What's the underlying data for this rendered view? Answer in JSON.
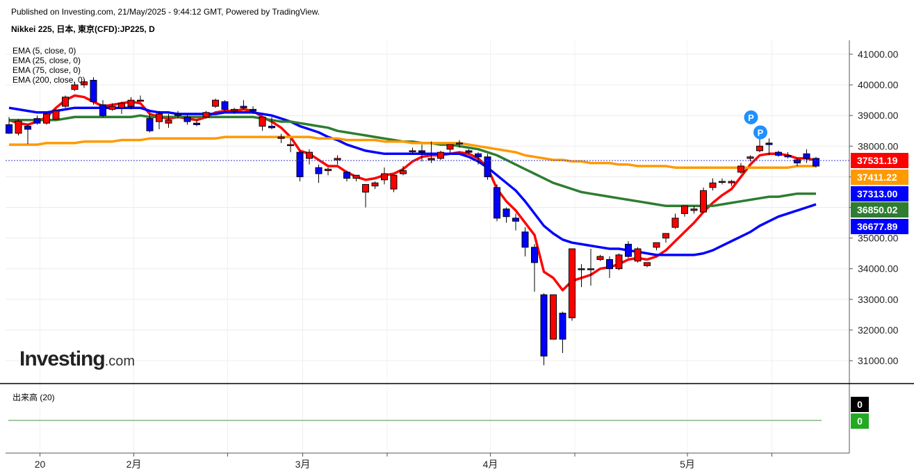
{
  "header": {
    "published": "Published on Investing.com, 21/May/2025 - 9:44:12 GMT, Powered by TradingView.",
    "symbol": "Nikkei 225, 日本, 東京(CFD):JP225, D"
  },
  "logo": {
    "main": "Investing",
    "suffix": ".com"
  },
  "volume": {
    "label": "出来高 (20)",
    "values": [
      "0",
      "0"
    ],
    "colors": [
      "#000000",
      "#22aa22"
    ]
  },
  "chart_data": {
    "type": "candlestick",
    "x_tick_labels": [
      "20",
      "2月",
      "3月",
      "4月",
      "5月"
    ],
    "y_tick_labels": [
      "31000.00",
      "32000.00",
      "33000.00",
      "34000.00",
      "35000.00",
      "36000.00",
      "37000.00",
      "38000.00",
      "39000.00",
      "40000.00",
      "41000.00"
    ],
    "ylim": [
      30000,
      41500
    ],
    "candles": [
      [
        38700,
        38950,
        38400,
        38420
      ],
      [
        38420,
        38880,
        38350,
        38820
      ],
      [
        38650,
        38700,
        38070,
        38550
      ],
      [
        38900,
        39000,
        38700,
        38750
      ],
      [
        38750,
        39100,
        38700,
        39050
      ],
      [
        38880,
        39200,
        38850,
        39150
      ],
      [
        39300,
        39650,
        39250,
        39600
      ],
      [
        39850,
        40100,
        39800,
        40000
      ],
      [
        40000,
        40200,
        39900,
        40100
      ],
      [
        40150,
        40250,
        39350,
        39450
      ],
      [
        39350,
        39500,
        38950,
        39000
      ],
      [
        39200,
        39400,
        39150,
        39300
      ],
      [
        39250,
        39450,
        39050,
        39400
      ],
      [
        39300,
        39600,
        39200,
        39500
      ],
      [
        39500,
        39650,
        39450,
        39500
      ],
      [
        38900,
        39050,
        38450,
        38500
      ],
      [
        38800,
        39150,
        38550,
        39050
      ],
      [
        38750,
        39050,
        38600,
        38850
      ],
      [
        39050,
        39150,
        38900,
        39000
      ],
      [
        38950,
        39050,
        38700,
        38800
      ],
      [
        38750,
        38850,
        38650,
        38700
      ],
      [
        38950,
        39150,
        38900,
        39100
      ],
      [
        39300,
        39550,
        39250,
        39500
      ],
      [
        39450,
        39500,
        39150,
        39200
      ],
      [
        39150,
        39250,
        39050,
        39200
      ],
      [
        39300,
        39500,
        39200,
        39250
      ],
      [
        39200,
        39300,
        39050,
        39150
      ],
      [
        38650,
        38950,
        38500,
        38950
      ],
      [
        38650,
        38950,
        38550,
        38600
      ],
      [
        38250,
        38400,
        38100,
        38300
      ],
      [
        38050,
        38250,
        37800,
        38050
      ],
      [
        37800,
        37850,
        36850,
        37000
      ],
      [
        37600,
        37900,
        37400,
        37800
      ],
      [
        37300,
        37400,
        36800,
        37100
      ],
      [
        37200,
        37300,
        37050,
        37250
      ],
      [
        37550,
        37700,
        37400,
        37600
      ],
      [
        37150,
        37200,
        36850,
        36950
      ],
      [
        36950,
        37050,
        36850,
        37050
      ],
      [
        36500,
        36750,
        36000,
        36750
      ],
      [
        36700,
        36850,
        36600,
        36800
      ],
      [
        36900,
        37300,
        36750,
        37100
      ],
      [
        36600,
        37050,
        36500,
        37050
      ],
      [
        37100,
        37350,
        37050,
        37200
      ],
      [
        37850,
        37950,
        37750,
        37850
      ],
      [
        37850,
        38050,
        37500,
        37800
      ],
      [
        37550,
        38150,
        37450,
        37600
      ],
      [
        37600,
        37850,
        37550,
        37800
      ],
      [
        37900,
        38050,
        37750,
        38050
      ],
      [
        38100,
        38200,
        37950,
        38100
      ],
      [
        37850,
        37900,
        37750,
        37800
      ],
      [
        37750,
        37800,
        37400,
        37650
      ],
      [
        37650,
        37750,
        36900,
        37000
      ],
      [
        36650,
        36750,
        35550,
        35650
      ],
      [
        35950,
        36000,
        35500,
        35700
      ],
      [
        35650,
        35800,
        35250,
        35550
      ],
      [
        35200,
        35350,
        34400,
        34700
      ],
      [
        34700,
        34800,
        33250,
        34200
      ],
      [
        33150,
        33200,
        30850,
        31150
      ],
      [
        31700,
        33150,
        31700,
        33150
      ],
      [
        32550,
        32600,
        31250,
        31700
      ],
      [
        32400,
        34650,
        32300,
        34650
      ],
      [
        34000,
        34150,
        33400,
        34000
      ],
      [
        34000,
        34650,
        33450,
        34000
      ],
      [
        34300,
        34450,
        34250,
        34400
      ],
      [
        34300,
        34400,
        33700,
        34000
      ],
      [
        34000,
        34500,
        33950,
        34450
      ],
      [
        34800,
        34900,
        34350,
        34400
      ],
      [
        34250,
        34700,
        34200,
        34650
      ],
      [
        34100,
        34200,
        34050,
        34200
      ],
      [
        34700,
        34850,
        34600,
        34850
      ],
      [
        35000,
        35150,
        34850,
        35150
      ],
      [
        35350,
        35800,
        35300,
        35650
      ],
      [
        35800,
        36000,
        35700,
        36050
      ],
      [
        35900,
        36050,
        35800,
        35950
      ],
      [
        35850,
        36650,
        35850,
        36550
      ],
      [
        36650,
        36950,
        36550,
        36800
      ],
      [
        36850,
        36950,
        36750,
        36850
      ],
      [
        36800,
        36900,
        36700,
        36850
      ],
      [
        37150,
        37450,
        37100,
        37350
      ],
      [
        37600,
        37700,
        37500,
        37650
      ],
      [
        37850,
        38500,
        37800,
        38000
      ],
      [
        38100,
        38250,
        37700,
        38050
      ],
      [
        37800,
        37850,
        37650,
        37700
      ],
      [
        37700,
        37800,
        37600,
        37650
      ],
      [
        37550,
        37600,
        37350,
        37450
      ],
      [
        37750,
        37900,
        37450,
        37600
      ],
      [
        37600,
        37650,
        37300,
        37350
      ]
    ],
    "series": [
      {
        "name": "EMA (5, close, 0)",
        "color": "#ff0000",
        "last_value": "37531.19",
        "values": [
          38850,
          38750,
          38700,
          38800,
          38950,
          39250,
          39500,
          39650,
          39600,
          39450,
          39300,
          39350,
          39400,
          39450,
          39400,
          39050,
          38950,
          38900,
          38950,
          38900,
          38850,
          38950,
          39100,
          39150,
          39150,
          39200,
          39150,
          38950,
          38800,
          38600,
          38300,
          37850,
          37750,
          37550,
          37350,
          37350,
          37150,
          37000,
          36900,
          36950,
          37050,
          37100,
          37250,
          37500,
          37650,
          37700,
          37700,
          37750,
          37800,
          37750,
          37600,
          37300,
          36600,
          36200,
          35900,
          35500,
          35100,
          33900,
          33700,
          33300,
          33600,
          33700,
          33800,
          34000,
          34050,
          34150,
          34300,
          34350,
          34300,
          34400,
          34600,
          34900,
          35200,
          35500,
          35850,
          36150,
          36400,
          36600,
          37000,
          37400,
          37700,
          37750,
          37750,
          37700,
          37600,
          37600,
          37531
        ]
      },
      {
        "name": "EMA (25, close, 0)",
        "color": "#0000ff",
        "last_value": "37313.00",
        "values": [
          39250,
          39200,
          39150,
          39100,
          39100,
          39150,
          39200,
          39250,
          39250,
          39250,
          39250,
          39250,
          39250,
          39250,
          39250,
          39150,
          39100,
          39100,
          39050,
          39050,
          39050,
          39050,
          39050,
          39100,
          39100,
          39100,
          39100,
          39050,
          39000,
          38900,
          38800,
          38650,
          38550,
          38450,
          38300,
          38200,
          38050,
          37950,
          37850,
          37800,
          37750,
          37750,
          37750,
          37750,
          37750,
          37750,
          37750,
          37750,
          37750,
          37650,
          37500,
          37300,
          37050,
          36800,
          36550,
          36200,
          35800,
          35400,
          35150,
          34950,
          34850,
          34800,
          34750,
          34700,
          34650,
          34650,
          34600,
          34550,
          34500,
          34450,
          34450,
          34450,
          34450,
          34450,
          34500,
          34600,
          34750,
          34900,
          35050,
          35200,
          35400,
          35550,
          35700,
          35800,
          35900,
          36000,
          36100
        ]
      },
      {
        "name": "EMA (75, close, 0)",
        "color": "#2e7d32",
        "last_value": "36850.02",
        "values": [
          38850,
          38850,
          38850,
          38850,
          38850,
          38850,
          38900,
          38950,
          38950,
          38950,
          38950,
          38950,
          38950,
          38950,
          39000,
          38950,
          38950,
          38950,
          38950,
          38950,
          38950,
          38950,
          38950,
          38950,
          38950,
          38950,
          38950,
          38900,
          38850,
          38800,
          38800,
          38750,
          38700,
          38650,
          38600,
          38500,
          38450,
          38400,
          38350,
          38300,
          38250,
          38200,
          38150,
          38150,
          38100,
          38100,
          38050,
          38050,
          38000,
          37950,
          37900,
          37800,
          37700,
          37550,
          37400,
          37250,
          37100,
          36950,
          36800,
          36700,
          36600,
          36500,
          36450,
          36400,
          36350,
          36300,
          36250,
          36200,
          36150,
          36100,
          36050,
          36050,
          36050,
          36050,
          36050,
          36050,
          36100,
          36150,
          36200,
          36250,
          36300,
          36350,
          36350,
          36400,
          36450,
          36450,
          36450
        ]
      },
      {
        "name": "EMA (200, close, 0)",
        "color": "#ff9900",
        "last_value": "37411.22",
        "values": [
          38050,
          38050,
          38050,
          38050,
          38100,
          38100,
          38100,
          38100,
          38150,
          38150,
          38150,
          38150,
          38200,
          38200,
          38200,
          38250,
          38250,
          38250,
          38250,
          38250,
          38250,
          38250,
          38250,
          38300,
          38300,
          38300,
          38300,
          38300,
          38300,
          38300,
          38300,
          38300,
          38300,
          38250,
          38250,
          38250,
          38200,
          38200,
          38200,
          38200,
          38150,
          38150,
          38150,
          38100,
          38100,
          38100,
          38100,
          38100,
          38100,
          38050,
          38000,
          37950,
          37900,
          37850,
          37800,
          37700,
          37650,
          37600,
          37550,
          37550,
          37500,
          37500,
          37450,
          37450,
          37450,
          37400,
          37400,
          37350,
          37350,
          37350,
          37350,
          37300,
          37300,
          37300,
          37300,
          37300,
          37300,
          37300,
          37300,
          37300,
          37300,
          37300,
          37300,
          37300,
          37350,
          37350,
          37350
        ]
      }
    ],
    "last_price": "37531.19",
    "last_price_color": "#ff0000",
    "marker_label": "P",
    "candle_up_color": "#ff0000",
    "candle_down_color": "#0000ff",
    "grid": true
  }
}
